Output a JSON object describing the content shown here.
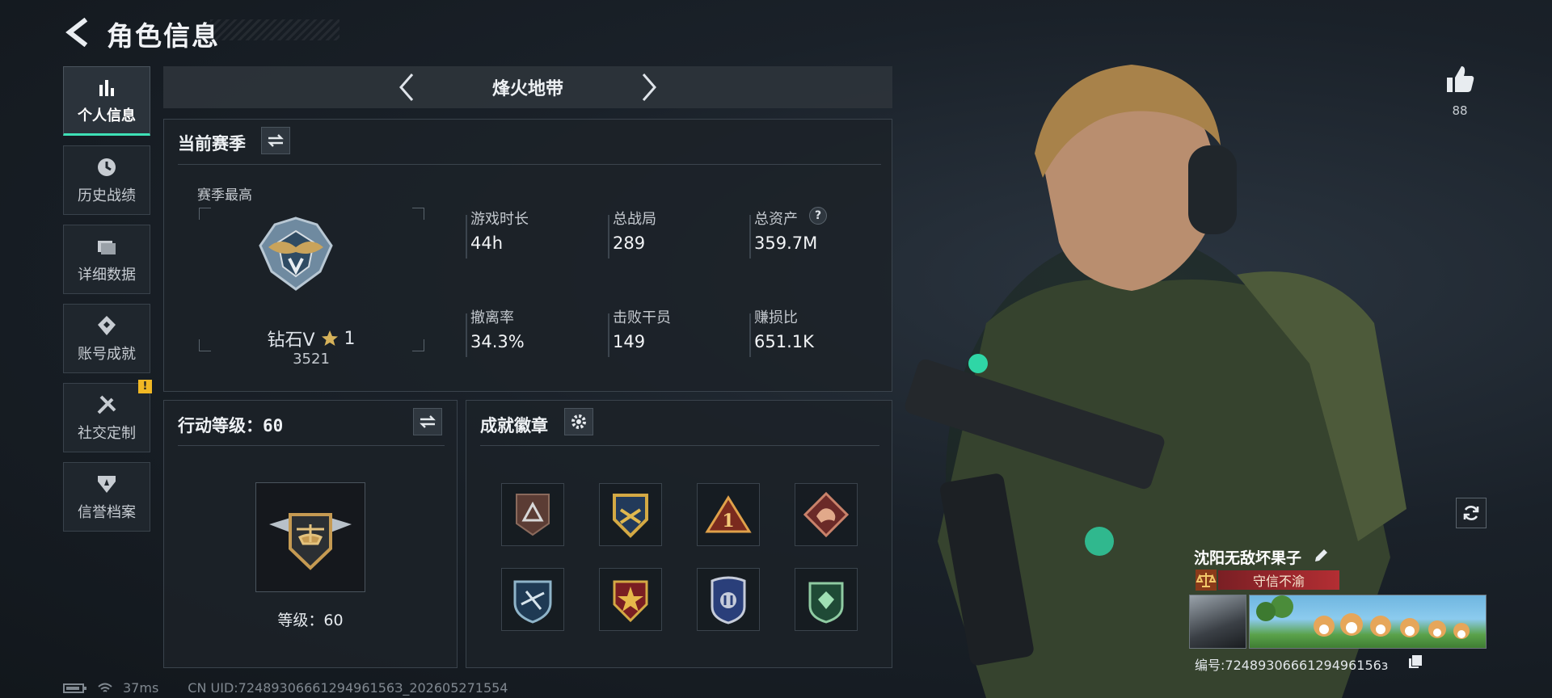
{
  "header": {
    "title": "角色信息"
  },
  "sidebar": {
    "items": [
      {
        "label": "个人信息",
        "icon": "bar-chart-icon",
        "active": true
      },
      {
        "label": "历史战绩",
        "icon": "clock-icon"
      },
      {
        "label": "详细数据",
        "icon": "folder-icon"
      },
      {
        "label": "账号成就",
        "icon": "achievement-icon"
      },
      {
        "label": "社交定制",
        "icon": "tools-icon",
        "badge": "!"
      },
      {
        "label": "信誉档案",
        "icon": "shield-icon"
      }
    ]
  },
  "mode": {
    "name": "烽火地带"
  },
  "season": {
    "title": "当前赛季",
    "best_label": "赛季最高",
    "rank_name": "钻石V",
    "rank_stars": "1",
    "rank_score": "3521",
    "stats": [
      {
        "label": "游戏时长",
        "value": "44h"
      },
      {
        "label": "总战局",
        "value": "289"
      },
      {
        "label": "总资产",
        "value": "359.7M",
        "help": "?"
      },
      {
        "label": "撤离率",
        "value": "34.3%"
      },
      {
        "label": "击败干员",
        "value": "149"
      },
      {
        "label": "赚损比",
        "value": "651.1K"
      }
    ]
  },
  "action_level": {
    "title": "行动等级：60",
    "level_text": "等级：60"
  },
  "achievements": {
    "title": "成就徽章",
    "badges": [
      "badge-1",
      "badge-2",
      "badge-3",
      "badge-4",
      "badge-5",
      "badge-6",
      "badge-7",
      "badge-8"
    ]
  },
  "profile": {
    "name": "沈阳无敌坏果子",
    "honor_title": "守信不渝",
    "id_text": "编号:7248930666129496156з",
    "likes": "88"
  },
  "status_bar": {
    "ping": "37ms",
    "uid": "CN UID:7248930666129496156З_202605271554"
  },
  "colors": {
    "accent": "#3ee0b6",
    "warning": "#f1b824",
    "banner": "#b32e33"
  }
}
